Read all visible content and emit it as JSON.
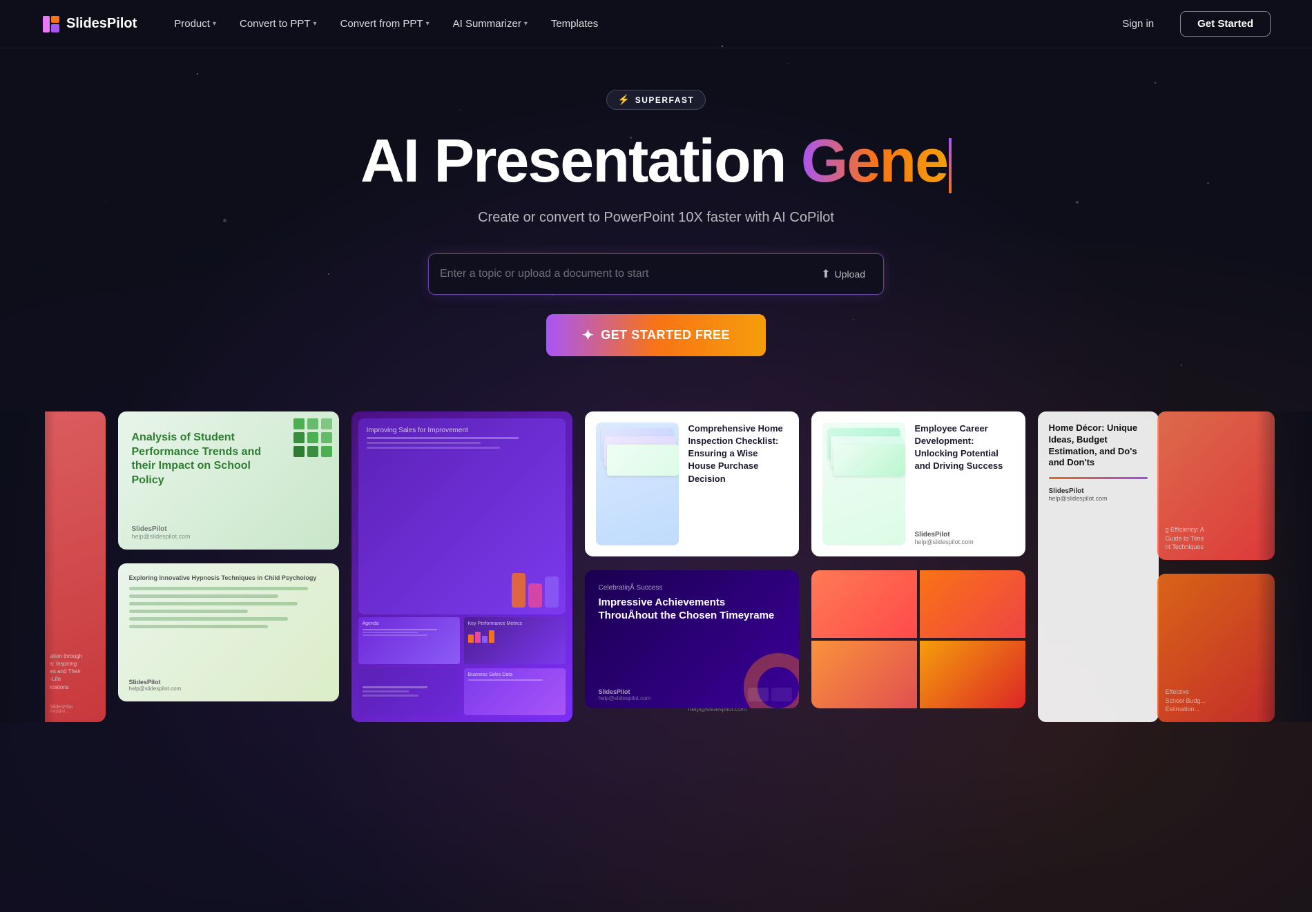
{
  "logo": {
    "name": "SlidesPilot",
    "icon": "P"
  },
  "nav": {
    "links": [
      {
        "label": "Product",
        "has_dropdown": true
      },
      {
        "label": "Convert to PPT",
        "has_dropdown": true
      },
      {
        "label": "Convert from PPT",
        "has_dropdown": true
      },
      {
        "label": "AI Summarizer",
        "has_dropdown": true
      },
      {
        "label": "Templates",
        "has_dropdown": false
      }
    ],
    "sign_in": "Sign in",
    "get_started": "Get Started"
  },
  "hero": {
    "badge": "SUPERFAST",
    "title_white": "AI Presentation ",
    "title_gradient": "Gene",
    "subtitle": "Create or convert to PowerPoint 10X faster with AI CoPilot",
    "input_placeholder": "Enter a topic or upload a document to start",
    "upload_label": "Upload",
    "cta_label": "GET STARTED FREE"
  },
  "gallery": {
    "cards": [
      {
        "type": "academic",
        "title": "Analysis of Student Performance Trends and their Impact on School Policy",
        "brand": "SlidesPilot",
        "email": "help@slidespilot.com"
      },
      {
        "type": "purple-slides",
        "slides_count": 4
      },
      {
        "type": "inspection",
        "title": "Comprehensive Home Inspection Checklist: Ensuring a Wise House Purchase Decision",
        "brand": "SlidesPilot",
        "email": "help@slidespilot.com"
      },
      {
        "type": "decor",
        "title": "Home Décor: Unique Ideas, Budget Estimation, and Do's and Don'ts",
        "brand": "SlidesPilot",
        "email": "help@slidespilot.com"
      },
      {
        "type": "green-small",
        "title": "Exploring Innovative Hypnosis Techniques in Child Psychology"
      },
      {
        "type": "celebration",
        "title": "CelebratiŋÅ Success: Impressive Achievements ThrouÅhout the Chosen Timeyrame"
      },
      {
        "type": "employee",
        "title": "Employee Career Development: Unlocking Potential and Driving Success"
      }
    ],
    "left_partial_titles": [
      "ation through s: Inspiring es and Their -Life ications",
      "g Efficiency: A Guide to Time nt Techniques"
    ]
  },
  "colors": {
    "bg": "#0d0e1a",
    "accent_purple": "#a855f7",
    "accent_orange": "#f97316",
    "accent_yellow": "#f59e0b",
    "nav_border": "rgba(255,255,255,0.07)"
  }
}
